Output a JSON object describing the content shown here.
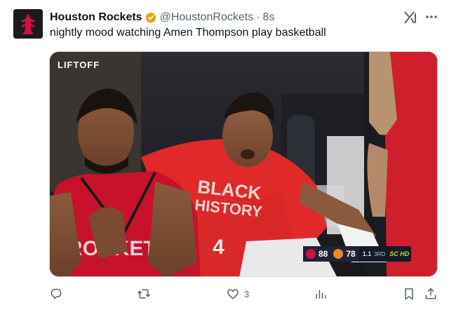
{
  "author": {
    "display_name": "Houston Rockets",
    "handle": "@HoustonRockets",
    "separator": "·",
    "time": "8s",
    "verified_color": "#e8a317"
  },
  "tweet": {
    "text": "nightly mood watching Amen Thompson play basketball"
  },
  "media": {
    "watermark": "LIFTOFF",
    "scorebug": {
      "home_score": "88",
      "away_score": "78",
      "period_time": "1.1",
      "quarter": "3RD",
      "network": "SC HD"
    },
    "jersey_number": "4"
  },
  "actions": {
    "reply_icon": "reply-icon",
    "retweet_icon": "retweet-icon",
    "like_count": "3",
    "views_icon": "views-icon",
    "bookmark_icon": "bookmark-icon",
    "share_icon": "share-icon"
  },
  "colors": {
    "rockets_red": "#ce1141",
    "text_primary": "#0f1419",
    "text_secondary": "#536471"
  }
}
